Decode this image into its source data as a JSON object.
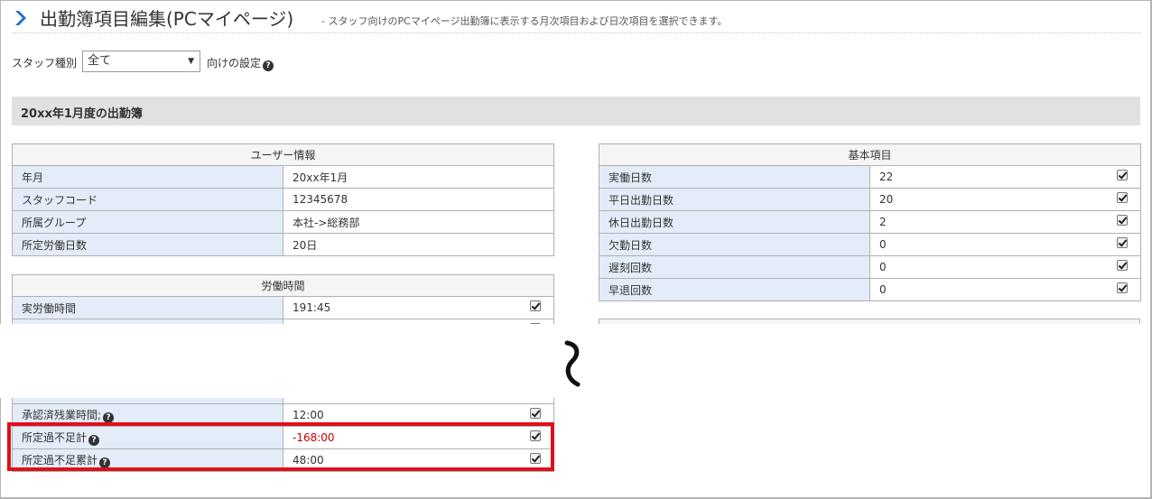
{
  "header": {
    "title": "出勤簿項目編集(PCマイページ)",
    "description": "- スタッフ向けのPCマイページ出勤簿に表示する月次項目および日次項目を選択できます。"
  },
  "staff_filter": {
    "label": "スタッフ種別",
    "selected": "全て",
    "suffix": "向けの設定"
  },
  "section": {
    "title": "20xx年1月度の出勤簿"
  },
  "user_info": {
    "header": "ユーザー情報",
    "rows": [
      {
        "label": "年月",
        "value": "20xx年1月"
      },
      {
        "label": "スタッフコード",
        "value": "12345678"
      },
      {
        "label": "所属グループ",
        "value": "本社->総務部"
      },
      {
        "label": "所定労働日数",
        "value": "20日"
      }
    ]
  },
  "work_time": {
    "header": "労働時間",
    "rows": [
      {
        "label": "実労働時間",
        "value": "191:45",
        "checked": true
      }
    ]
  },
  "work_time_lower": {
    "rows": [
      {
        "label": "承認済残業時間;",
        "value": "12:00",
        "checked": true,
        "help": true
      },
      {
        "label": "所定過不足計",
        "value": "-168:00",
        "checked": true,
        "help": true
      },
      {
        "label": "所定過不足累計",
        "value": "48:00",
        "checked": true,
        "help": true
      }
    ]
  },
  "basic_items": {
    "header": "基本項目",
    "rows": [
      {
        "label": "実働日数",
        "value": "22",
        "checked": true
      },
      {
        "label": "平日出勤日数",
        "value": "20",
        "checked": true
      },
      {
        "label": "休日出勤日数",
        "value": "2",
        "checked": true
      },
      {
        "label": "欠勤日数",
        "value": "0",
        "checked": true
      },
      {
        "label": "遅刻回数",
        "value": "0",
        "checked": true
      },
      {
        "label": "早退回数",
        "value": "0",
        "checked": true
      }
    ]
  },
  "icons": {
    "title": "chevron-right-icon",
    "help": "question-circle-icon",
    "break": "wave-break-icon",
    "accent": "#1f6fd0",
    "highlight": "#e00f1c",
    "negative": "#cc0000"
  }
}
